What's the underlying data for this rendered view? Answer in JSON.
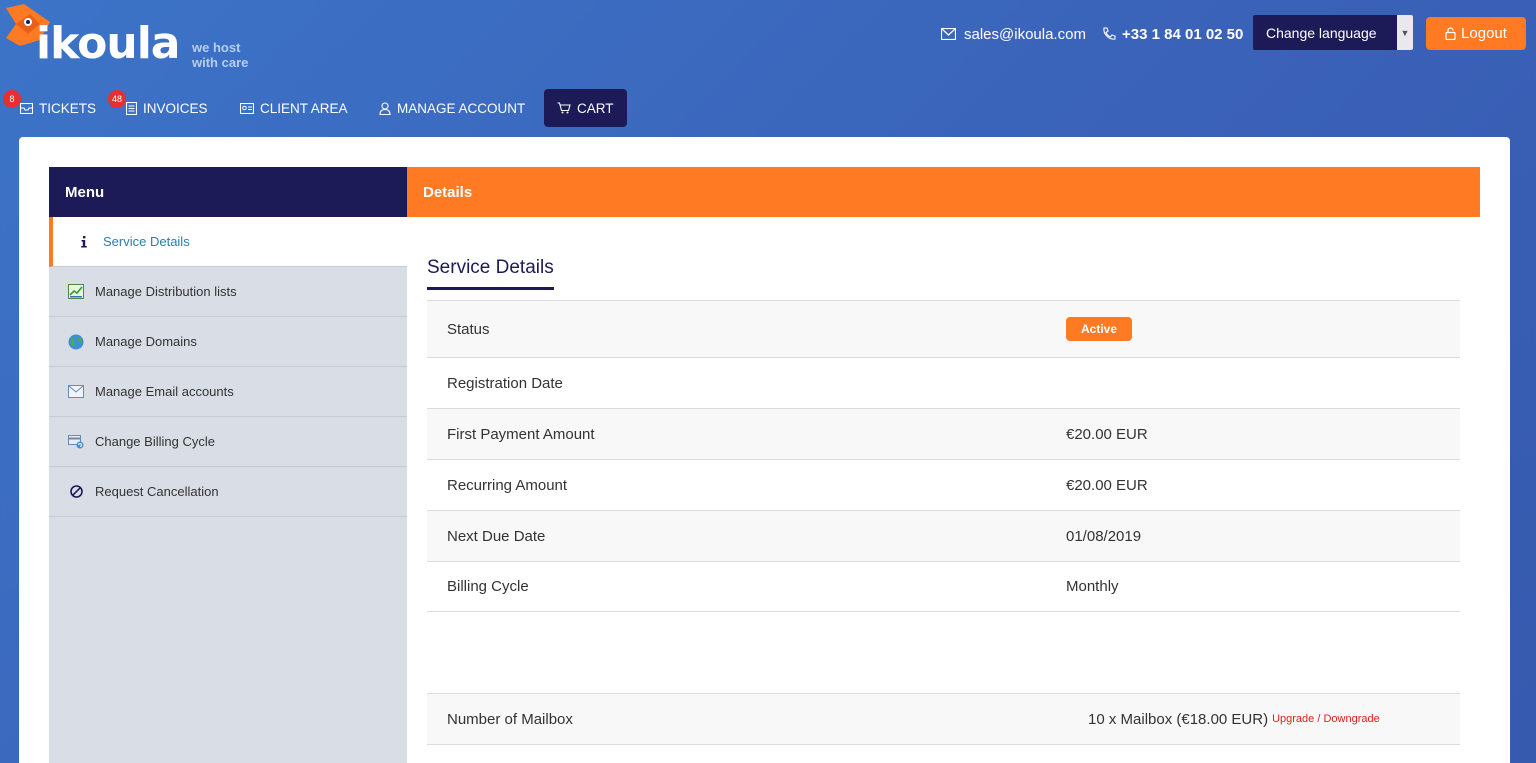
{
  "brand": {
    "name": "ikoula",
    "tagline_line1": "we host",
    "tagline_line2": "with care",
    "colors": {
      "navy": "#1c1a57",
      "orange": "#ff7a22",
      "blue": "#3c74c8"
    }
  },
  "header": {
    "email": "sales@ikoula.com",
    "phone": "+33 1 84 01 02 50",
    "language_label": "Change language",
    "logout_label": "Logout"
  },
  "nav": {
    "items": [
      {
        "label": "TICKETS",
        "icon": "envelope-icon",
        "badge": "8"
      },
      {
        "label": "INVOICES",
        "icon": "document-icon",
        "badge": "48"
      },
      {
        "label": "CLIENT AREA",
        "icon": "id-card-icon"
      },
      {
        "label": "MANAGE ACCOUNT",
        "icon": "user-icon"
      },
      {
        "label": "CART",
        "icon": "cart-icon"
      }
    ]
  },
  "sidebar": {
    "title": "Menu",
    "items": [
      {
        "label": "Service Details",
        "icon": "info-icon",
        "active": true
      },
      {
        "label": "Manage Distribution lists",
        "icon": "list-chart-icon"
      },
      {
        "label": "Manage Domains",
        "icon": "globe-icon"
      },
      {
        "label": "Manage Email accounts",
        "icon": "mail-icon"
      },
      {
        "label": "Change Billing Cycle",
        "icon": "billing-cycle-icon"
      },
      {
        "label": "Request Cancellation",
        "icon": "ban-icon"
      }
    ]
  },
  "details": {
    "header": "Details",
    "section_title": "Service Details",
    "rows": [
      {
        "label": "Status",
        "value": "Active"
      },
      {
        "label": "Registration Date",
        "value": ""
      },
      {
        "label": "First Payment Amount",
        "value": "€20.00 EUR"
      },
      {
        "label": "Recurring Amount",
        "value": "€20.00 EUR"
      },
      {
        "label": "Next Due Date",
        "value": "01/08/2019"
      },
      {
        "label": "Billing Cycle",
        "value": "Monthly"
      }
    ],
    "mailbox": {
      "label": "Number of Mailbox",
      "value": "10 x Mailbox (€18.00 EUR)",
      "link": "Upgrade / Downgrade"
    }
  }
}
